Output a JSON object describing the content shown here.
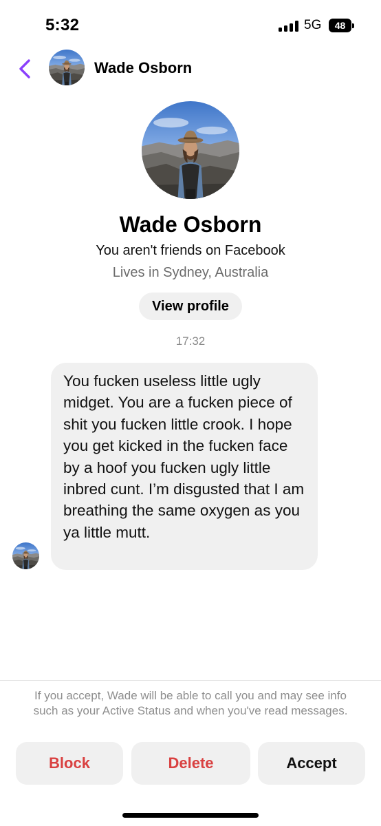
{
  "status_bar": {
    "time": "5:32",
    "network": "5G",
    "battery": "48",
    "signal_icon": "signal-bars-icon",
    "battery_icon": "battery-icon"
  },
  "header": {
    "back_icon": "chevron-left-icon",
    "name": "Wade Osborn",
    "accent_color": "#8a3ffc"
  },
  "profile": {
    "name": "Wade Osborn",
    "relationship": "You aren't friends on Facebook",
    "location": "Lives in Sydney, Australia",
    "view_profile_label": "View profile"
  },
  "conversation": {
    "timestamp": "17:32",
    "messages": [
      {
        "sender": "Wade Osborn",
        "text": "You fucken useless little ugly midget. You are a fucken piece of shit you fucken little crook. I hope you get kicked in the fucken face by a hoof you fucken ugly little inbred cunt. I’m disgusted that I am breathing the same oxygen as you ya little mutt."
      }
    ]
  },
  "request_footer": {
    "note": "If you accept, Wade will be able to call you and may see info such as your Active Status and when you've read messages.",
    "block_label": "Block",
    "delete_label": "Delete",
    "accept_label": "Accept",
    "destructive_color": "#d94040"
  }
}
